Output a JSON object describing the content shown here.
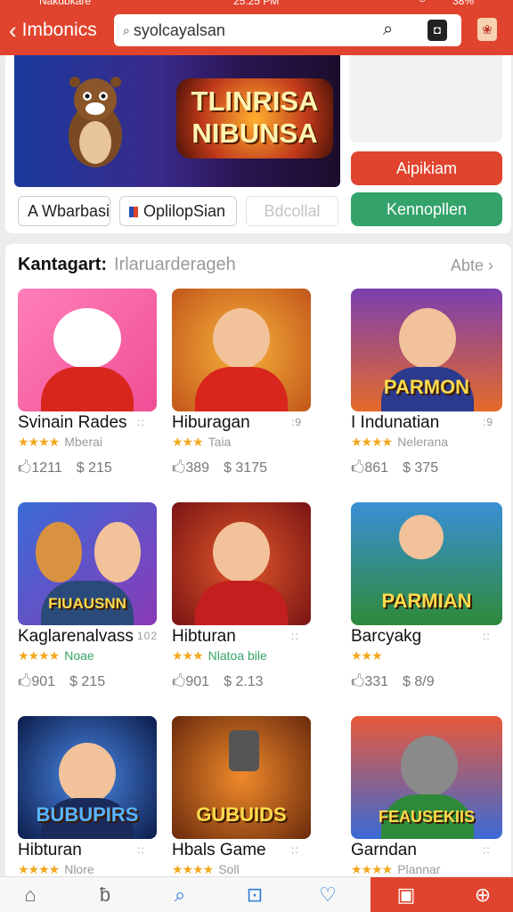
{
  "status_bar": {
    "carrier": "Nakdbkare",
    "time": "25:25 PM",
    "battery": "38%"
  },
  "header": {
    "back_label": "Imbonics",
    "search_value": "syolcayalsan"
  },
  "top": {
    "banner_logo": "TLINRISA NIBUNSA",
    "btn_red": "Aipikiam",
    "btn_green": "Kennopllen",
    "chips": [
      "A Wbarbasi",
      "OplilopSian",
      "Bdcollal"
    ]
  },
  "section": {
    "title": "Kantagart:",
    "subtitle": "Irlaruarderageh",
    "more": "Abte"
  },
  "cards": [
    {
      "name": "Svinain Rades",
      "more": "::",
      "rating": "Mberai",
      "likes": "1211",
      "coins": "215",
      "tag": ""
    },
    {
      "name": "Hiburagan",
      "more": ":9",
      "rating": "Taia",
      "likes": "389",
      "coins": "3175",
      "tag": ""
    },
    {
      "name": "I Indunatian",
      "more": ":9",
      "rating": "Nelerana",
      "likes": "861",
      "coins": "375",
      "tag": "PARMON"
    },
    {
      "name": "Kaglarenalvass",
      "more": "102",
      "rating": "Noae",
      "likes": "901",
      "coins": "215",
      "tag": "FIUAUSNN"
    },
    {
      "name": "Hibturan",
      "more": "::",
      "rating": "Nlatoa bile",
      "likes": "901",
      "coins": "2.13",
      "tag": ""
    },
    {
      "name": "Barcyakg",
      "more": "::",
      "rating": "",
      "likes": "331",
      "coins": "8/9",
      "tag": "PARMIAN"
    },
    {
      "name": "Hibturan",
      "more": "::",
      "rating": "Nlore",
      "likes": "",
      "coins": "",
      "tag": "BUBUPIRS"
    },
    {
      "name": "Hbals Game",
      "more": "::",
      "rating": "Soll",
      "likes": "",
      "coins": "",
      "tag": "GUBUIDS"
    },
    {
      "name": "Garndan",
      "more": "::",
      "rating": "Plannar",
      "likes": "",
      "coins": "",
      "tag": "FEAUSEKIIS"
    }
  ]
}
